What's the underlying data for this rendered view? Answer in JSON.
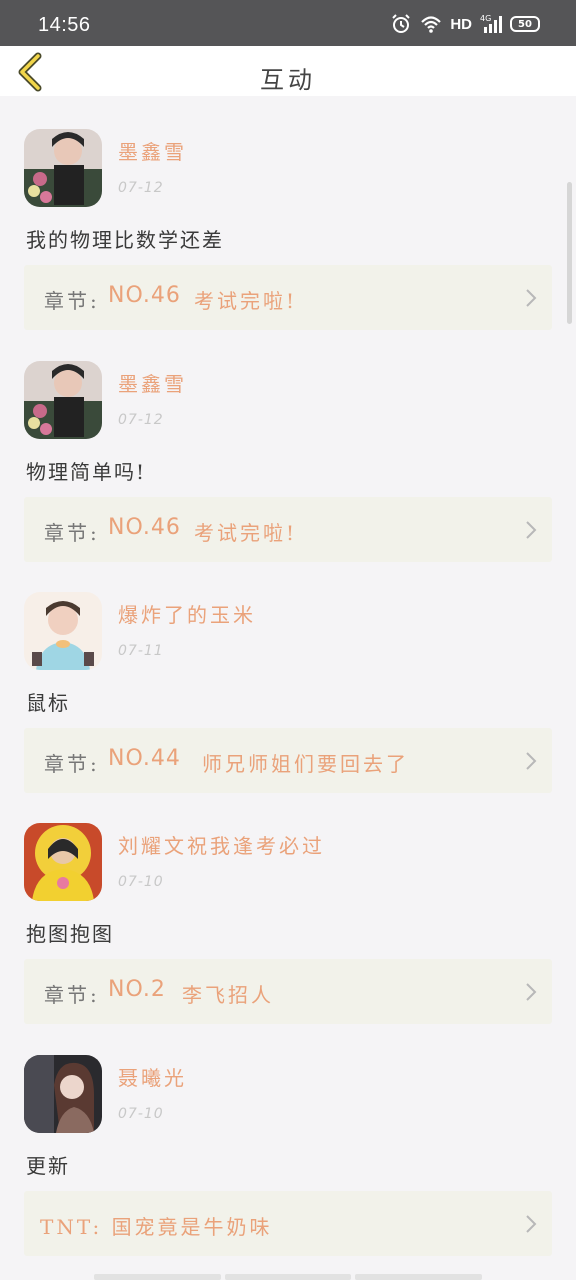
{
  "status_bar": {
    "time": "14:56",
    "network": "HD",
    "signal": "4G",
    "battery": "50"
  },
  "header": {
    "title": "互动"
  },
  "comments": [
    {
      "username": "墨鑫雪",
      "date": "07-12",
      "text": "我的物理比数学还差",
      "chapter_label": "章节:",
      "chapter_no": "NO.46",
      "chapter_title": "考试完啦!"
    },
    {
      "username": "墨鑫雪",
      "date": "07-12",
      "text": "物理简单吗!",
      "chapter_label": "章节:",
      "chapter_no": "NO.46",
      "chapter_title": "考试完啦!"
    },
    {
      "username": "爆炸了的玉米",
      "date": "07-11",
      "text": "鼠标",
      "chapter_label": "章节:",
      "chapter_no": "NO.44",
      "chapter_title": "师兄师姐们要回去了"
    },
    {
      "username": "刘耀文祝我逢考必过",
      "date": "07-10",
      "text": "抱图抱图",
      "chapter_label": "章节:",
      "chapter_no": "NO.2",
      "chapter_title": "李飞招人"
    },
    {
      "username": "聂曦光",
      "date": "07-10",
      "text": "更新",
      "chapter_full": "TNT: 国宠竟是牛奶味"
    }
  ],
  "colors": {
    "accent": "#eaa27a",
    "card": "#f2f2ea",
    "status_bar": "#555557"
  }
}
